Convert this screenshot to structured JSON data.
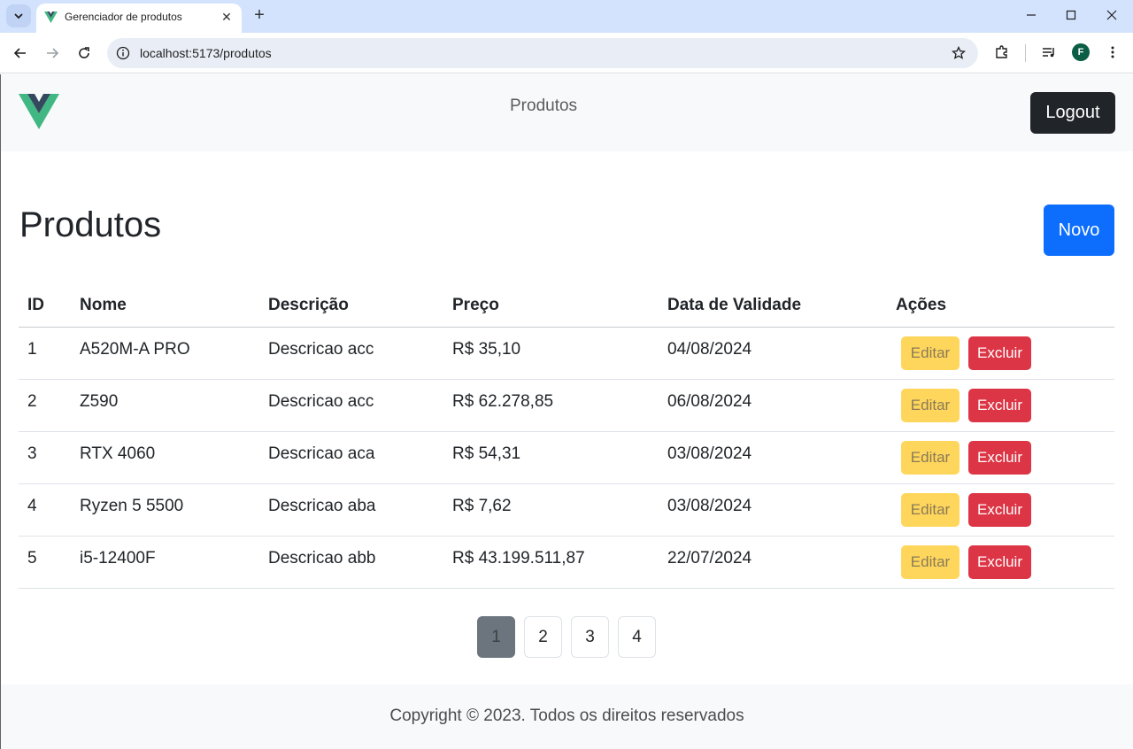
{
  "browser": {
    "tab_title": "Gerenciador de produtos",
    "url": "localhost:5173/produtos",
    "profile_initial": "F"
  },
  "navbar": {
    "link_label": "Produtos",
    "logout_label": "Logout"
  },
  "main": {
    "title": "Produtos",
    "new_label": "Novo"
  },
  "table": {
    "headers": [
      "ID",
      "Nome",
      "Descrição",
      "Preço",
      "Data de Validade",
      "Ações"
    ],
    "rows": [
      {
        "id": "1",
        "nome": "A520M-A PRO",
        "descricao": "Descricao acc",
        "preco": "R$ 35,10",
        "validade": "04/08/2024"
      },
      {
        "id": "2",
        "nome": "Z590",
        "descricao": "Descricao acc",
        "preco": "R$ 62.278,85",
        "validade": "06/08/2024"
      },
      {
        "id": "3",
        "nome": "RTX 4060",
        "descricao": "Descricao aca",
        "preco": "R$ 54,31",
        "validade": "03/08/2024"
      },
      {
        "id": "4",
        "nome": "Ryzen 5 5500",
        "descricao": "Descricao aba",
        "preco": "R$ 7,62",
        "validade": "03/08/2024"
      },
      {
        "id": "5",
        "nome": "i5-12400F",
        "descricao": "Descricao abb",
        "preco": "R$ 43.199.511,87",
        "validade": "22/07/2024"
      }
    ],
    "edit_label": "Editar",
    "delete_label": "Excluir"
  },
  "pagination": {
    "pages": [
      "1",
      "2",
      "3",
      "4"
    ],
    "current": "1"
  },
  "footer": {
    "copyright": "Copyright © 2023. Todos os direitos reservados"
  },
  "colors": {
    "primary": "#0d6efd",
    "warning": "#ffd65c",
    "danger": "#dc3545",
    "dark": "#212529",
    "vue_green": "#41b883",
    "vue_dark": "#34495e"
  }
}
